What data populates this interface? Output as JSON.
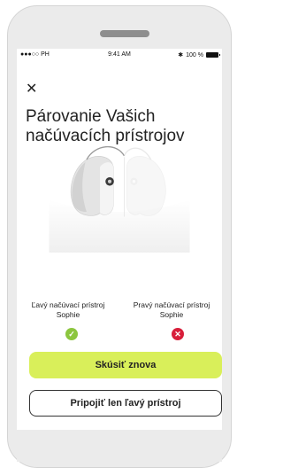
{
  "status_bar": {
    "carrier": "●●●○○ PH",
    "time": "9:41 AM",
    "battery": "100 %"
  },
  "header": {
    "close_icon": "close-icon",
    "title": "Párovanie Vašich načúvacích prístrojov"
  },
  "devices": {
    "left": {
      "label": "Ľavý načúvací prístroj Sophie",
      "status": "success",
      "status_icon": "check-icon",
      "status_color": "#8cc63f"
    },
    "right": {
      "label": "Pravý načúvací prístroj Sophie",
      "status": "error",
      "status_icon": "x-icon",
      "status_color": "#d81e3a"
    }
  },
  "actions": {
    "retry_label": "Skúsiť znova",
    "retry_color": "#d9ef5a",
    "connect_left_label": "Pripojiť len ľavý prístroj"
  }
}
